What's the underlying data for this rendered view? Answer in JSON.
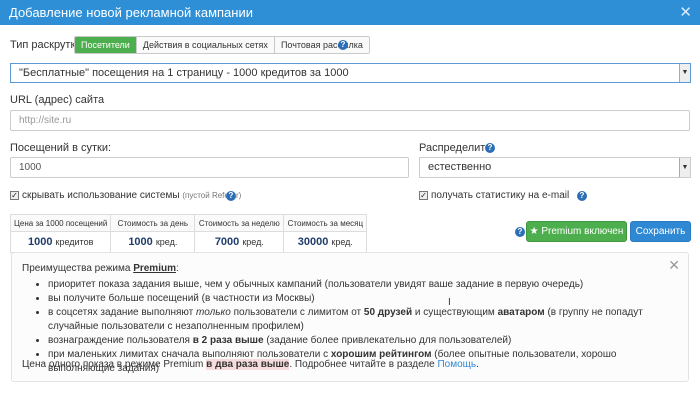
{
  "window": {
    "title": "Добавление новой рекламной кампании"
  },
  "promo_type": {
    "label": "Тип раскрутки:",
    "options": [
      "Посетители",
      "Действия в социальных сетях",
      "Почтовая рассылка"
    ],
    "active": "Посетители"
  },
  "package_select": {
    "value": "\"Бесплатные\" посещения на 1 страницу - 1000 кредитов за 1000"
  },
  "url_field": {
    "label": "URL (адрес) сайта",
    "placeholder": "http://site.ru"
  },
  "visits_field": {
    "label": "Посещений в сутки:",
    "value": "1000"
  },
  "distribute": {
    "label": "Распределить:",
    "value": "естественно"
  },
  "hide_system": {
    "label": "скрывать использование системы",
    "hint": "(пустой Referer)",
    "checked": true
  },
  "email_stats": {
    "label": "получать статистику на e-mail",
    "checked": true
  },
  "prices": {
    "headers": [
      "Цена за 1000 посещений",
      "Стоимость за день",
      "Стоимость за неделю",
      "Стоимость за месяц"
    ],
    "values": [
      {
        "amount": "1000",
        "unit": "кредитов"
      },
      {
        "amount": "1000",
        "unit": "кред."
      },
      {
        "amount": "7000",
        "unit": "кред."
      },
      {
        "amount": "30000",
        "unit": "кред."
      }
    ]
  },
  "buttons": {
    "premium": "Premium включен",
    "save": "Сохранить"
  },
  "premium_info": {
    "heading_prefix": "Преимущества режима",
    "heading_bold": "Premium",
    "heading_suffix": ":",
    "items": [
      {
        "parts": [
          {
            "t": "приоритет показа задания выше, чем у обычных кампаний (пользователи увидят ваше задание в первую очередь)",
            "s": "n"
          }
        ]
      },
      {
        "parts": [
          {
            "t": "вы получите больше посещений (в частности из Москвы)",
            "s": "n"
          }
        ]
      },
      {
        "parts": [
          {
            "t": "в соцсетях задание выполняют ",
            "s": "n"
          },
          {
            "t": "только",
            "s": "i"
          },
          {
            "t": " пользователи с лимитом от ",
            "s": "n"
          },
          {
            "t": "50 друзей",
            "s": "b"
          },
          {
            "t": " и существующим ",
            "s": "n"
          },
          {
            "t": "аватаром",
            "s": "b"
          },
          {
            "t": " (в группу не попадут случайные пользователи с незаполненным профилем)",
            "s": "n"
          }
        ]
      },
      {
        "parts": [
          {
            "t": "вознаграждение пользователя ",
            "s": "n"
          },
          {
            "t": "в 2 раза выше",
            "s": "b"
          },
          {
            "t": " (задание более привлекательно для пользователей)",
            "s": "n"
          }
        ]
      },
      {
        "parts": [
          {
            "t": "при маленьких лимитах сначала выполняют пользователи с ",
            "s": "n"
          },
          {
            "t": "хорошим рейтингом",
            "s": "b"
          },
          {
            "t": " (более опытные пользователи, хорошо выполняющие задания)",
            "s": "n"
          }
        ]
      }
    ],
    "footer_prefix": "Цена одного показа в режиме Premium ",
    "footer_highlight": "в два раза выше",
    "footer_middle": ". Подробнее читайте в разделе ",
    "footer_link": "Помощь",
    "footer_end": "."
  },
  "colors": {
    "titlebar": "#2e8fd6",
    "green": "#4dae4d",
    "blue": "#2e88d4",
    "help_icon": "#2c6fb7"
  }
}
